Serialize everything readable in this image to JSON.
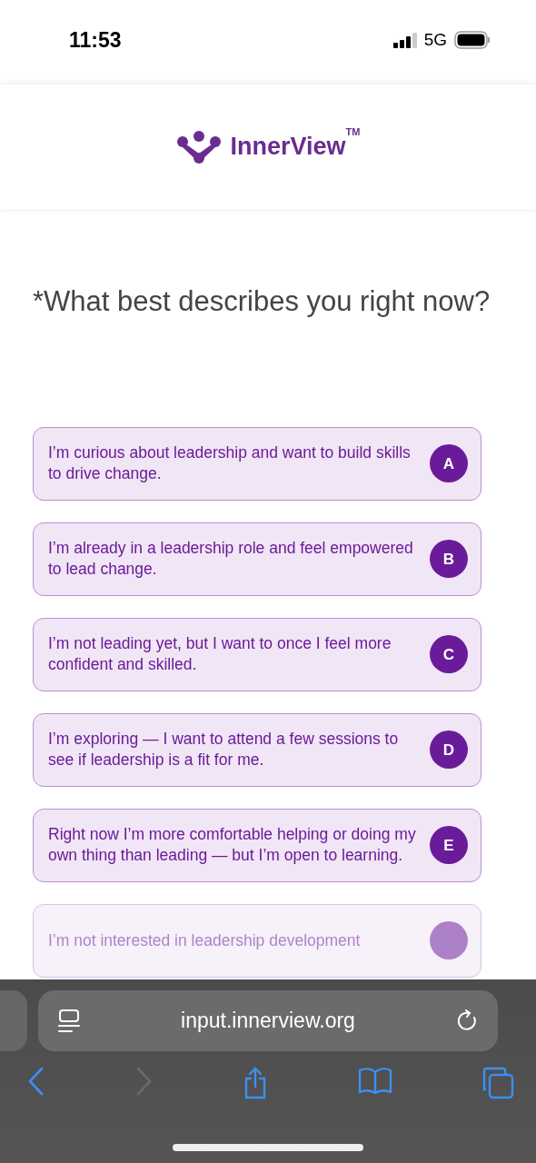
{
  "status_bar": {
    "time": "11:53",
    "network": "5G"
  },
  "header": {
    "brand": "InnerView",
    "trademark": "TM"
  },
  "question": "*What best describes you right now?",
  "options": [
    {
      "letter": "A",
      "text": "I’m curious about leadership and want to build skills to drive change."
    },
    {
      "letter": "B",
      "text": "I’m already in a leadership role and feel empowered to lead change."
    },
    {
      "letter": "C",
      "text": "I’m not leading yet, but I want to once I feel more confident and skilled."
    },
    {
      "letter": "D",
      "text": "I’m exploring — I want to attend a few sessions to see if leadership is a fit for me."
    },
    {
      "letter": "E",
      "text": "Right now I’m more comfortable helping or doing my own thing than leading — but I’m open to learning."
    },
    {
      "text": "I’m not interested in leadership development"
    }
  ],
  "browser": {
    "url": "input.innerview.org"
  }
}
